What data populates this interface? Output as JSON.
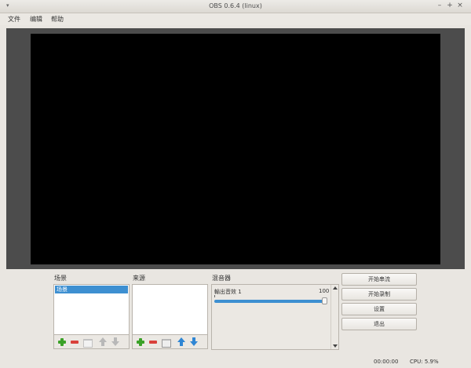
{
  "window": {
    "title": "OBS 0.6.4 (linux)"
  },
  "menu": [
    "文件",
    "编辑",
    "帮助"
  ],
  "panels": {
    "scenes": "场景",
    "sources": "来源",
    "mixer": "混音器"
  },
  "scenes": {
    "items": [
      "场景"
    ]
  },
  "mixer": {
    "channel_name": "輸出音效 1",
    "volume": "100",
    "level": 1.0
  },
  "controls": {
    "start_stream": "开始串流",
    "start_record": "开始录制",
    "settings": "设置",
    "exit": "退出"
  },
  "status": {
    "time": "00:00:00",
    "cpu": "CPU: 5.9%"
  }
}
